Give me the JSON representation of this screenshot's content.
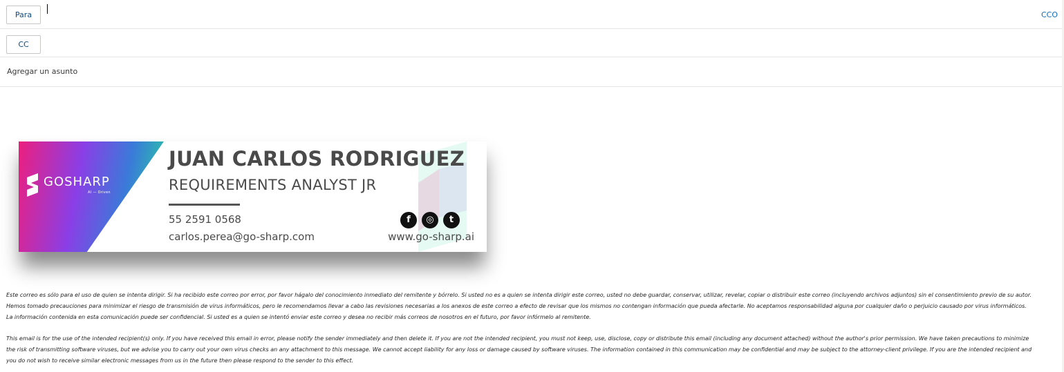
{
  "compose": {
    "to_label": "Para",
    "cc_label": "CC",
    "bcc_label": "CCO",
    "subject_placeholder": "Agregar un asunto"
  },
  "signature": {
    "logo_text": "GOSHARP",
    "logo_tagline": "AI — Driven",
    "name": "JUAN CARLOS RODRIGUEZ",
    "job_title": "REQUIREMENTS ANALYST JR",
    "phone": "55 2591 0568",
    "email": "carlos.perea@go-sharp.com",
    "website": "www.go-sharp.ai",
    "social": [
      {
        "name": "facebook-icon",
        "glyph": "f"
      },
      {
        "name": "instagram-icon",
        "glyph": "◎"
      },
      {
        "name": "twitter-icon",
        "glyph": "t"
      }
    ],
    "colors": {
      "gradient_start": "#ec1f7e",
      "gradient_mid": "#8a3fe6",
      "gradient_end": "#26d79a",
      "text": "#4a4a4a"
    }
  },
  "disclaimer": {
    "es_lines": [
      "Este correo es sólo para el uso de quien se intenta dirigir. Si ha recibido este correo por error, por favor hágalo del conocimiento inmediato del remitente y bórrelo. Si usted no es a quien se intenta dirigir este correo, usted no debe guardar, conservar, utilizar, revelar, copiar o distribuir este correo (incluyendo archivos adjuntos) sin el consentimiento previo de su autor.",
      "Hemos tomado precauciones para minimizar el riesgo de transmisión de virus informáticos, pero le recomendamos llevar a cabo las revisiones necesarias a los anexos de este correo a efecto de revisar que los mismos no contengan información que pueda afectarle. No aceptamos responsabilidad alguna por cualquier daño o perjuicio causado por virus informáticos.",
      "La información contenida en esta comunicación puede ser confidencial. Si usted es a quien se intentó enviar este correo y desea no recibir más correos de nosotros en el futuro, por favor infórmelo al remitente."
    ],
    "en_lines": [
      "This email is for the use of the intended recipient(s) only. If you have received this email in error, please notify the sender immediately and then delete it. If you are not the intended recipient, you must not keep, use, disclose, copy or distribute this email (including any document attached) without the author's prior permission. We have taken precautions to minimize",
      "the risk of transmitting software viruses, but we advise you to carry out your own virus checks an any attachment to this message. We cannot accept liability for any loss or damage caused by software viruses. The information contained in this communication may be confidential and may be subject to the attorney-client privilege. If you are the intended recipient and",
      "you do not wish to receive similar electronic messages from us in the future then please respond to the sender to this effect."
    ]
  }
}
